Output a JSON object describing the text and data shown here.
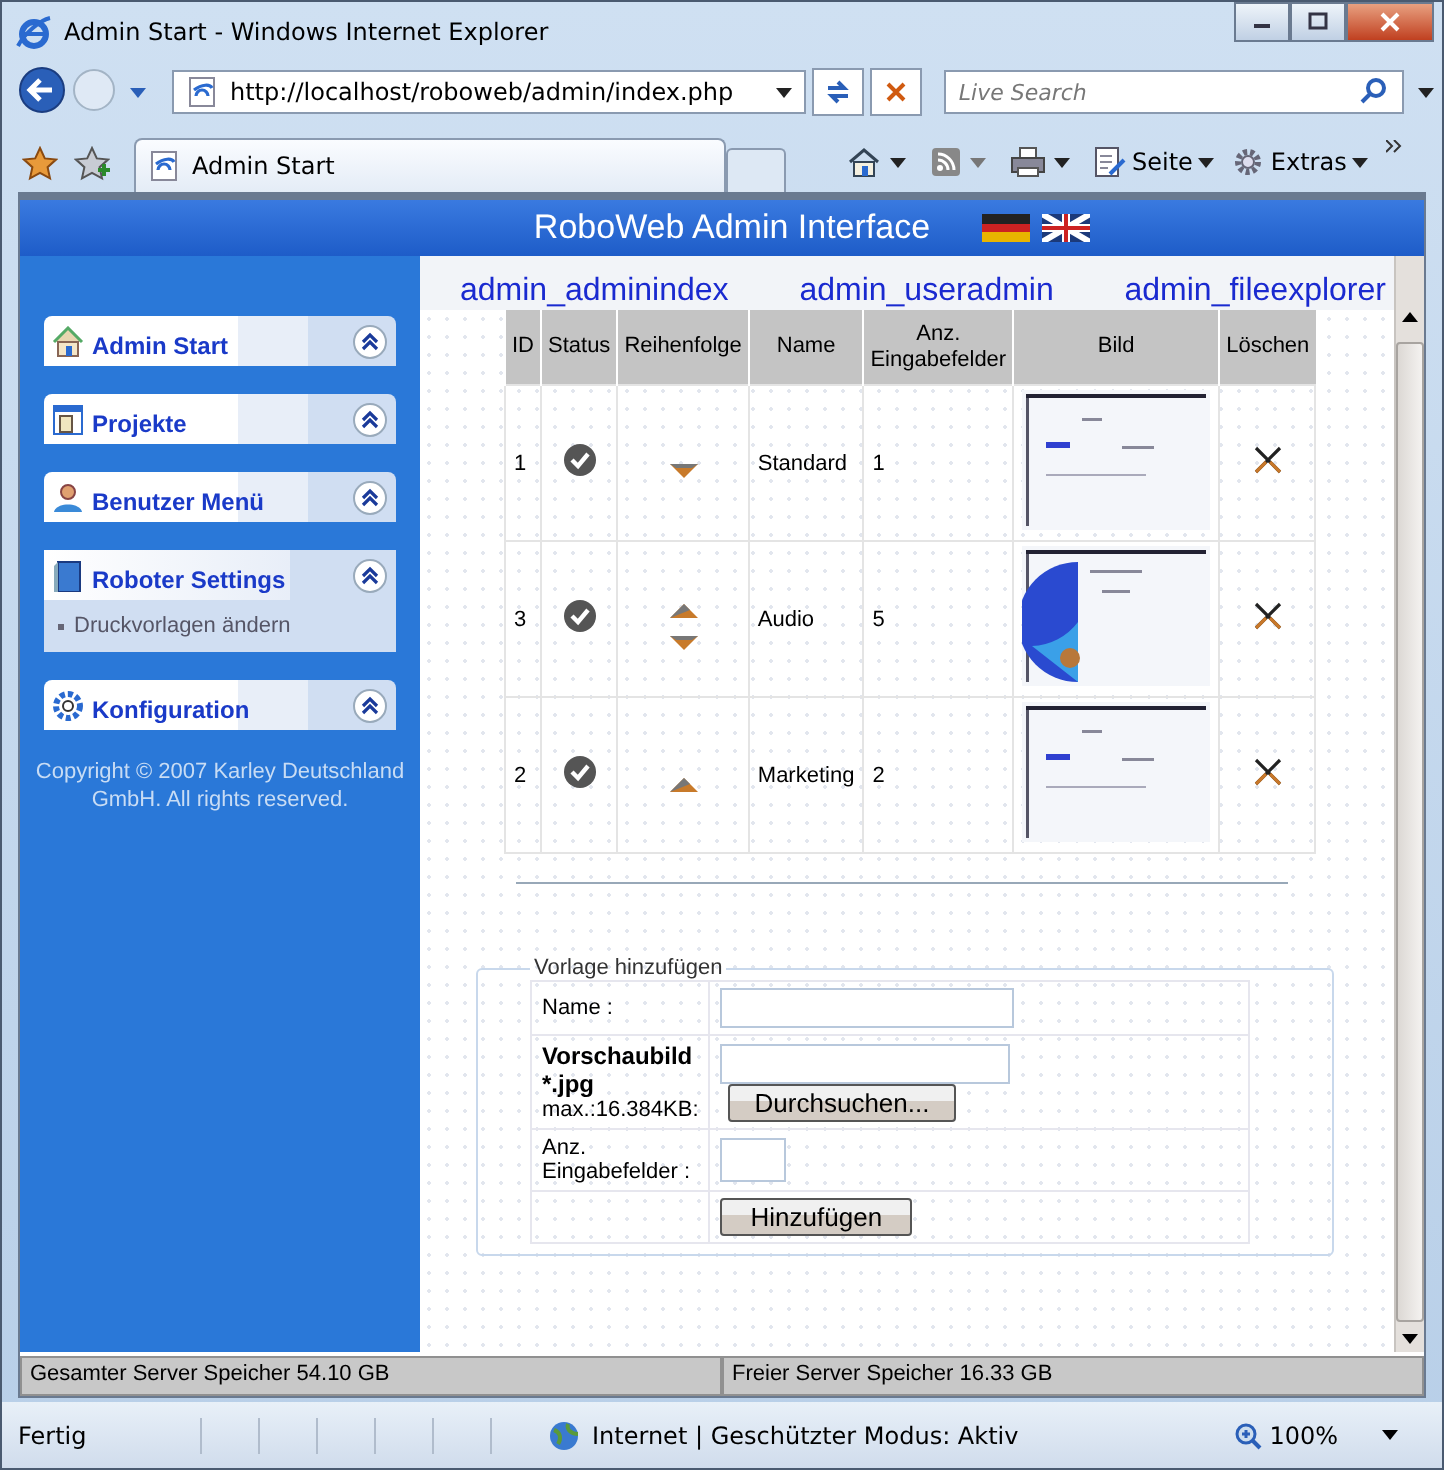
{
  "window": {
    "title": "Admin Start - Windows Internet Explorer"
  },
  "browser": {
    "address": "http://localhost/roboweb/admin/index.php",
    "search": {
      "placeholder": "Live Search"
    },
    "tab": "Admin Start",
    "commands": [
      "Seite",
      "Extras"
    ]
  },
  "page": {
    "title": "RoboWeb Admin Interface",
    "nav_links": [
      "admin_adminindex",
      "admin_useradmin",
      "admin_fileexplorer"
    ],
    "sidebar": {
      "items": [
        {
          "label": "Admin Start",
          "expanded": false
        },
        {
          "label": "Projekte",
          "expanded": false
        },
        {
          "label": "Benutzer Menü",
          "expanded": false
        },
        {
          "label": "Roboter Settings",
          "expanded": true,
          "children": [
            {
              "label": "Druckvorlagen ändern"
            }
          ]
        },
        {
          "label": "Konfiguration",
          "expanded": false
        }
      ],
      "copyright": "Copyright © 2007 Karley Deutschland GmbH. All rights reserved."
    },
    "table": {
      "columns": [
        "ID",
        "Status",
        "Reihenfolge",
        "Name",
        "Anz. Eingabefelder",
        "Bild",
        "Löschen"
      ],
      "rows": [
        {
          "id": "1",
          "name": "Standard",
          "fields": "1",
          "can_move_up": false,
          "can_move_down": true
        },
        {
          "id": "3",
          "name": "Audio",
          "fields": "5",
          "can_move_up": true,
          "can_move_down": true
        },
        {
          "id": "2",
          "name": "Marketing",
          "fields": "2",
          "can_move_up": true,
          "can_move_down": false
        }
      ]
    },
    "form": {
      "legend": "Vorlage hinzufügen",
      "name_label": "Name :",
      "image_label": "Vorschaubild *.jpg",
      "image_hint": "max.:16.384KB:",
      "browse_button": "Durchsuchen...",
      "fields_label": "Anz. Eingabefelder :",
      "submit_button": "Hinzufügen"
    },
    "server_bar": [
      "Gesamter Server Speicher 54.10 GB",
      "Freier Server Speicher 16.33 GB"
    ]
  },
  "status_bar": {
    "status": "Fertig",
    "zone": "Internet | Geschützter Modus: Aktiv",
    "zoom": "100%"
  }
}
